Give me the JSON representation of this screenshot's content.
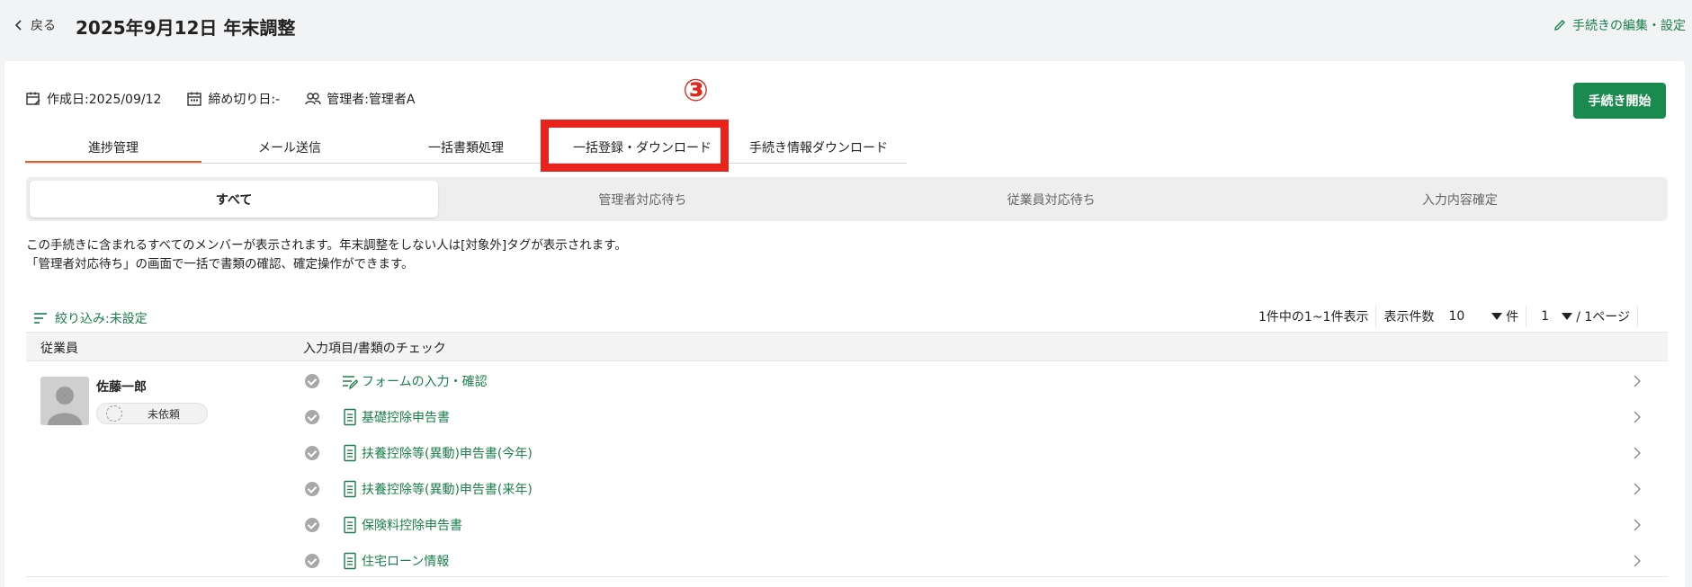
{
  "header": {
    "back_label": "戻る",
    "title": "2025年9月12日 年末調整",
    "edit_label": "手続きの編集・設定"
  },
  "meta": {
    "created": "作成日:2025/09/12",
    "deadline": "締め切り日:-",
    "manager": "管理者:管理者A"
  },
  "annotation": "③",
  "start_button": "手続き開始",
  "tabs": [
    {
      "label": "進捗管理",
      "active": true
    },
    {
      "label": "メール送信"
    },
    {
      "label": "一括書類処理"
    },
    {
      "label": "一括登録・ダウンロード"
    },
    {
      "label": "手続き情報ダウンロード"
    }
  ],
  "subtabs": [
    {
      "label": "すべて",
      "active": true
    },
    {
      "label": "管理者対応待ち"
    },
    {
      "label": "従業員対応待ち"
    },
    {
      "label": "入力内容確定"
    }
  ],
  "description": {
    "line1": "この手続きに含まれるすべてのメンバーが表示されます。年末調整をしない人は[対象外]タグが表示されます。",
    "line2": "「管理者対応待ち」の画面で一括で書類の確認、確定操作ができます。"
  },
  "filter_label": "絞り込み:未設定",
  "pager": {
    "summary": "1件中の1~1件表示",
    "per_page_label": "表示件数",
    "per_page_value": "10",
    "per_page_unit": "件",
    "page_value": "1",
    "page_suffix": "/ 1ページ"
  },
  "table": {
    "col_employee": "従業員",
    "col_check": "入力項目/書類のチェック"
  },
  "employee": {
    "name": "佐藤一郎",
    "status": "未依頼"
  },
  "items": [
    {
      "label": "フォームの入力・確認",
      "icon": "form-edit-icon"
    },
    {
      "label": "基礎控除申告書",
      "icon": "document-icon"
    },
    {
      "label": "扶養控除等(異動)申告書(今年)",
      "icon": "document-icon"
    },
    {
      "label": "扶養控除等(異動)申告書(来年)",
      "icon": "document-icon"
    },
    {
      "label": "保険料控除申告書",
      "icon": "document-icon"
    },
    {
      "label": "住宅ローン情報",
      "icon": "document-icon"
    }
  ],
  "colors": {
    "accent_green": "#1a8a4f",
    "link_green": "#1a7f4b",
    "tab_underline": "#e0622a",
    "highlight_red": "#e8231c"
  }
}
